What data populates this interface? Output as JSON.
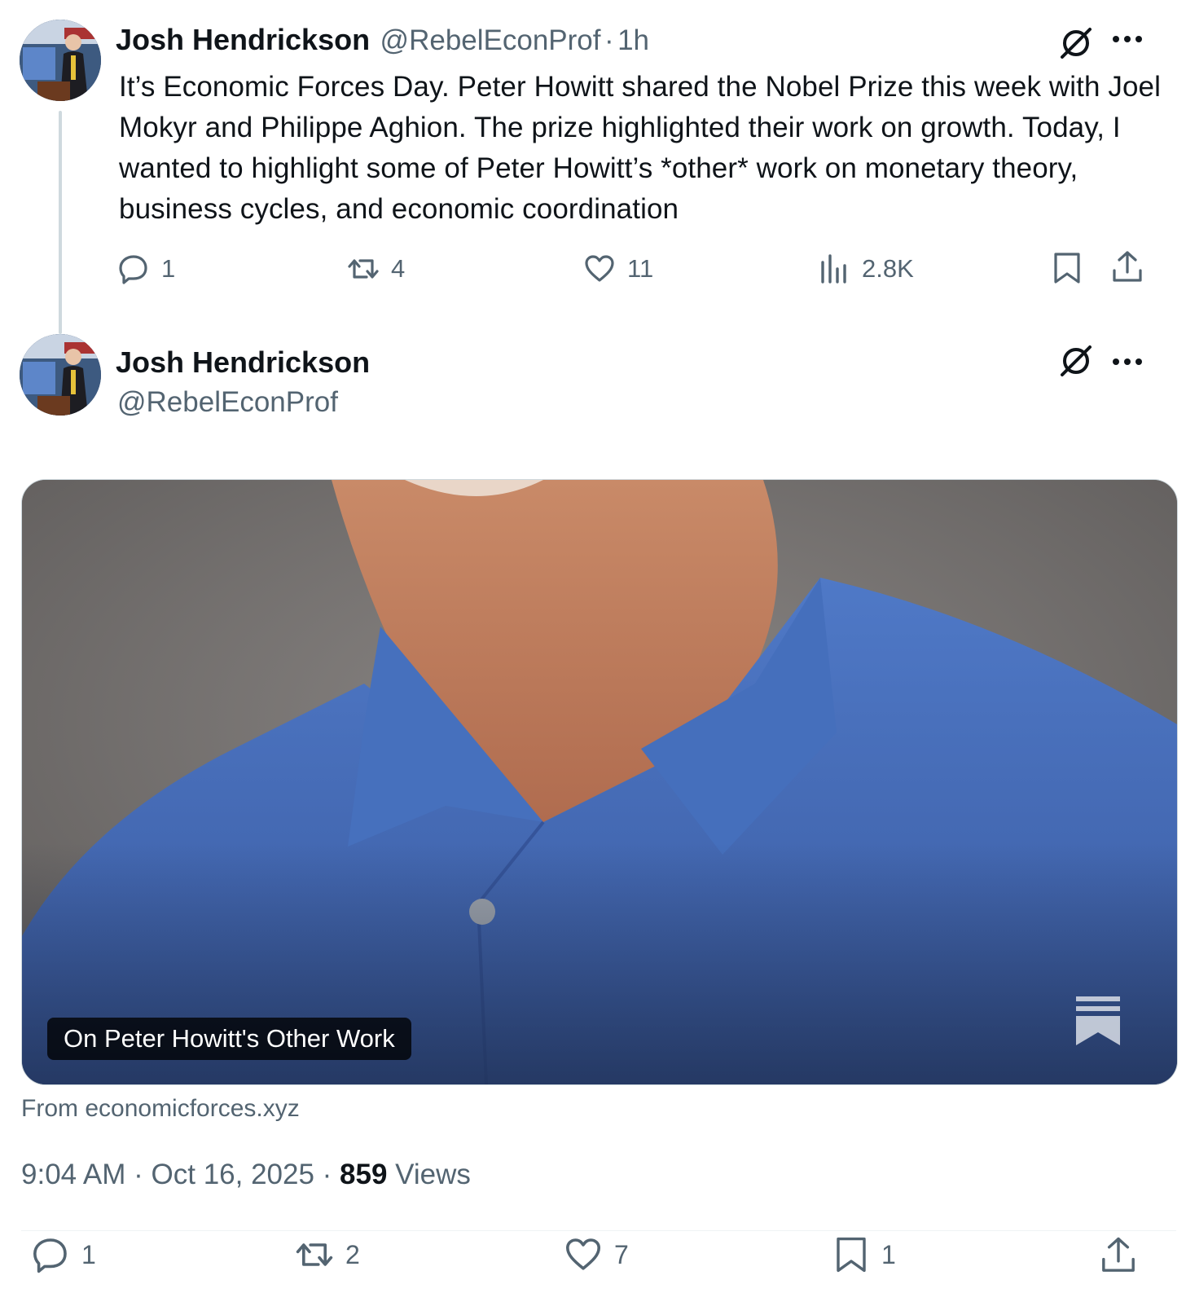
{
  "tweet1": {
    "name": "Josh Hendrickson",
    "handle": "@RebelEconProf",
    "separator": "·",
    "time": "1h",
    "text": "It’s Economic Forces Day. Peter Howitt shared the Nobel Prize this week with Joel Mokyr and Philippe Aghion. The prize highlighted their work on growth. Today, I wanted to highlight some of Peter Howitt’s *other* work on monetary theory, business cycles, and economic coordination",
    "actions": {
      "replies": "1",
      "reposts": "4",
      "likes": "11",
      "views": "2.8K"
    }
  },
  "tweet2": {
    "name": "Josh Hendrickson",
    "handle": "@RebelEconProf",
    "card": {
      "title": "On Peter Howitt's Other Work",
      "source": "From economicforces.xyz"
    },
    "timestamp": "9:04 AM · Oct 16, 2025 · ",
    "views_count": "859",
    "views_label": " Views",
    "actions": {
      "replies": "1",
      "reposts": "2",
      "likes": "7",
      "bookmarks": "1"
    }
  },
  "icons": {
    "grok": "grok-icon",
    "more": "more-icon",
    "reply": "reply-icon",
    "repost": "repost-icon",
    "like": "heart-icon",
    "views": "views-icon",
    "bookmark": "bookmark-icon",
    "share": "share-icon",
    "substack": "substack-icon"
  },
  "colors": {
    "text": "#0f1419",
    "secondary": "#536471",
    "thread_line": "#cfd9de",
    "shirt": "#4a6fb8"
  }
}
